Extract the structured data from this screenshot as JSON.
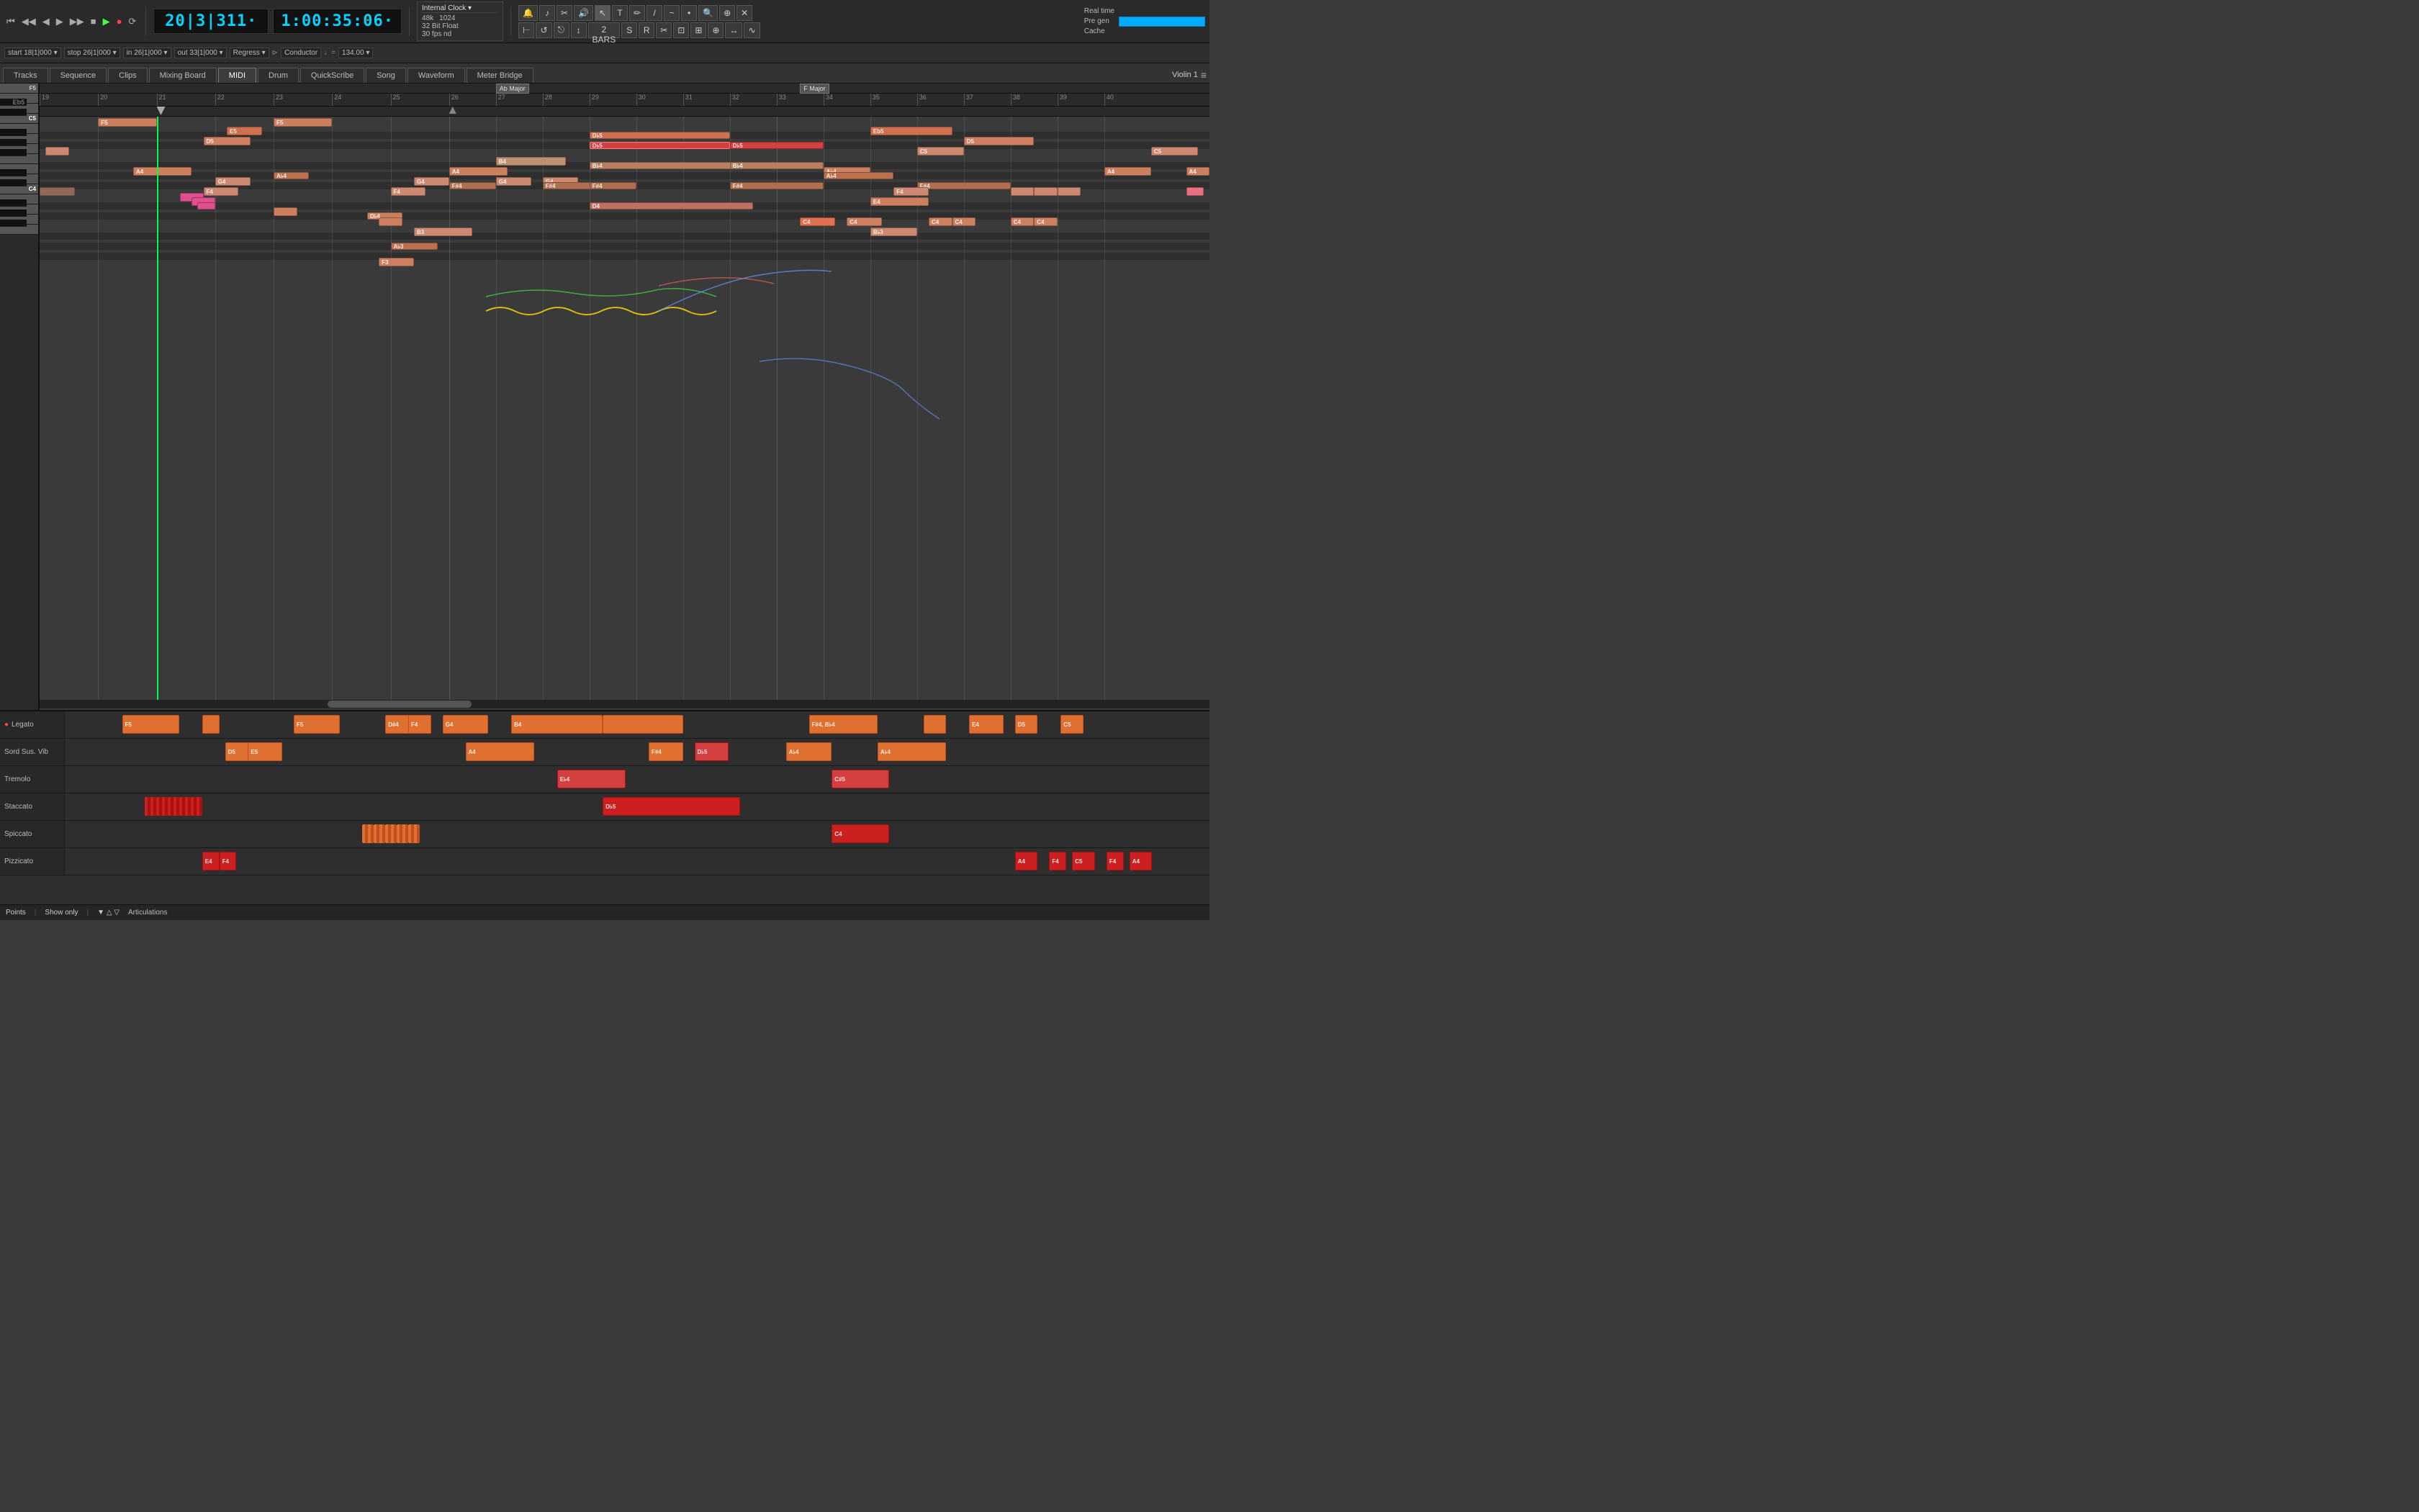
{
  "header": {
    "transport": {
      "position": "20|3|311·",
      "time": "1:00:35:06·",
      "rewind_label": "⏮",
      "fast_rewind": "◀◀",
      "rewind": "◀",
      "forward": "▶",
      "fast_forward": "▶▶",
      "stop_label": "■",
      "play_label": "▶",
      "record_label": "●",
      "loop_label": "⟳"
    },
    "clock": {
      "title": "Internal Clock ▾",
      "sample_rate": "48k",
      "bit_depth": "32 Bit Float",
      "fps": "30 fps nd",
      "buffer": "1024"
    },
    "position_bar": {
      "start": "start  18|1|000 ▾",
      "stop": "stop  26|1|000 ▾",
      "in": "in  26|1|000 ▾",
      "out": "out  33|1|000 ▾",
      "regress": "Regress ▾",
      "conductor": "Conductor",
      "tempo": "134.00 ▾"
    },
    "realtime": {
      "line1": "Real time",
      "line2": "Pre gen",
      "line3": "Cache"
    }
  },
  "tabs": [
    {
      "id": "tracks",
      "label": "Tracks"
    },
    {
      "id": "sequence",
      "label": "Sequence"
    },
    {
      "id": "clips",
      "label": "Clips"
    },
    {
      "id": "mixing",
      "label": "Mixing Board"
    },
    {
      "id": "midi",
      "label": "MIDI",
      "active": true
    },
    {
      "id": "drum",
      "label": "Drum"
    },
    {
      "id": "quickscribe",
      "label": "QuickScribe"
    },
    {
      "id": "song",
      "label": "Song"
    },
    {
      "id": "waveform",
      "label": "Waveform"
    },
    {
      "id": "meter",
      "label": "Meter Bridge"
    }
  ],
  "track_name": "Violin 1",
  "ruler_marks": [
    19,
    20,
    21,
    22,
    23,
    24,
    25,
    26,
    27,
    28,
    29,
    30,
    31,
    32,
    33,
    34,
    35,
    36,
    37,
    38,
    39,
    40
  ],
  "key_sigs": [
    {
      "label": "Ab Major",
      "position": 39
    },
    {
      "label": "F Major",
      "position": 65
    }
  ],
  "piano_keys": [
    {
      "note": "F5",
      "type": "white",
      "label": ""
    },
    {
      "note": "E5",
      "type": "white"
    },
    {
      "note": "Eb5",
      "type": "black"
    },
    {
      "note": "D5",
      "type": "white"
    },
    {
      "note": "Db5",
      "type": "black"
    },
    {
      "note": "C5",
      "type": "white",
      "label": "C5"
    },
    {
      "note": "B4",
      "type": "white"
    },
    {
      "note": "Bb4",
      "type": "black"
    },
    {
      "note": "A4",
      "type": "white"
    },
    {
      "note": "Ab4",
      "type": "black"
    },
    {
      "note": "G4",
      "type": "white"
    },
    {
      "note": "F#4",
      "type": "black"
    },
    {
      "note": "F4",
      "type": "white"
    },
    {
      "note": "E4",
      "type": "white"
    },
    {
      "note": "Eb4",
      "type": "black"
    },
    {
      "note": "D4",
      "type": "white"
    },
    {
      "note": "Db4",
      "type": "black"
    },
    {
      "note": "C4",
      "type": "white",
      "label": "C4"
    },
    {
      "note": "B3",
      "type": "white"
    },
    {
      "note": "Bb3",
      "type": "black"
    },
    {
      "note": "A3",
      "type": "white"
    },
    {
      "note": "Ab3",
      "type": "black"
    },
    {
      "note": "G3",
      "type": "white"
    },
    {
      "note": "F#3",
      "type": "black"
    },
    {
      "note": "F3",
      "type": "white"
    }
  ],
  "articulations": [
    {
      "label": "● Legato",
      "color": "orange"
    },
    {
      "label": "Sord Sus. Vib",
      "color": "orange"
    },
    {
      "label": "Tremolo",
      "color": "orange"
    },
    {
      "label": "Staccato",
      "color": "red"
    },
    {
      "label": "Spiccato",
      "color": "red"
    },
    {
      "label": "Pizzicato",
      "color": "red"
    }
  ],
  "status_bar": {
    "points": "Points",
    "show_only": "Show only",
    "articulations": "Articulations"
  }
}
